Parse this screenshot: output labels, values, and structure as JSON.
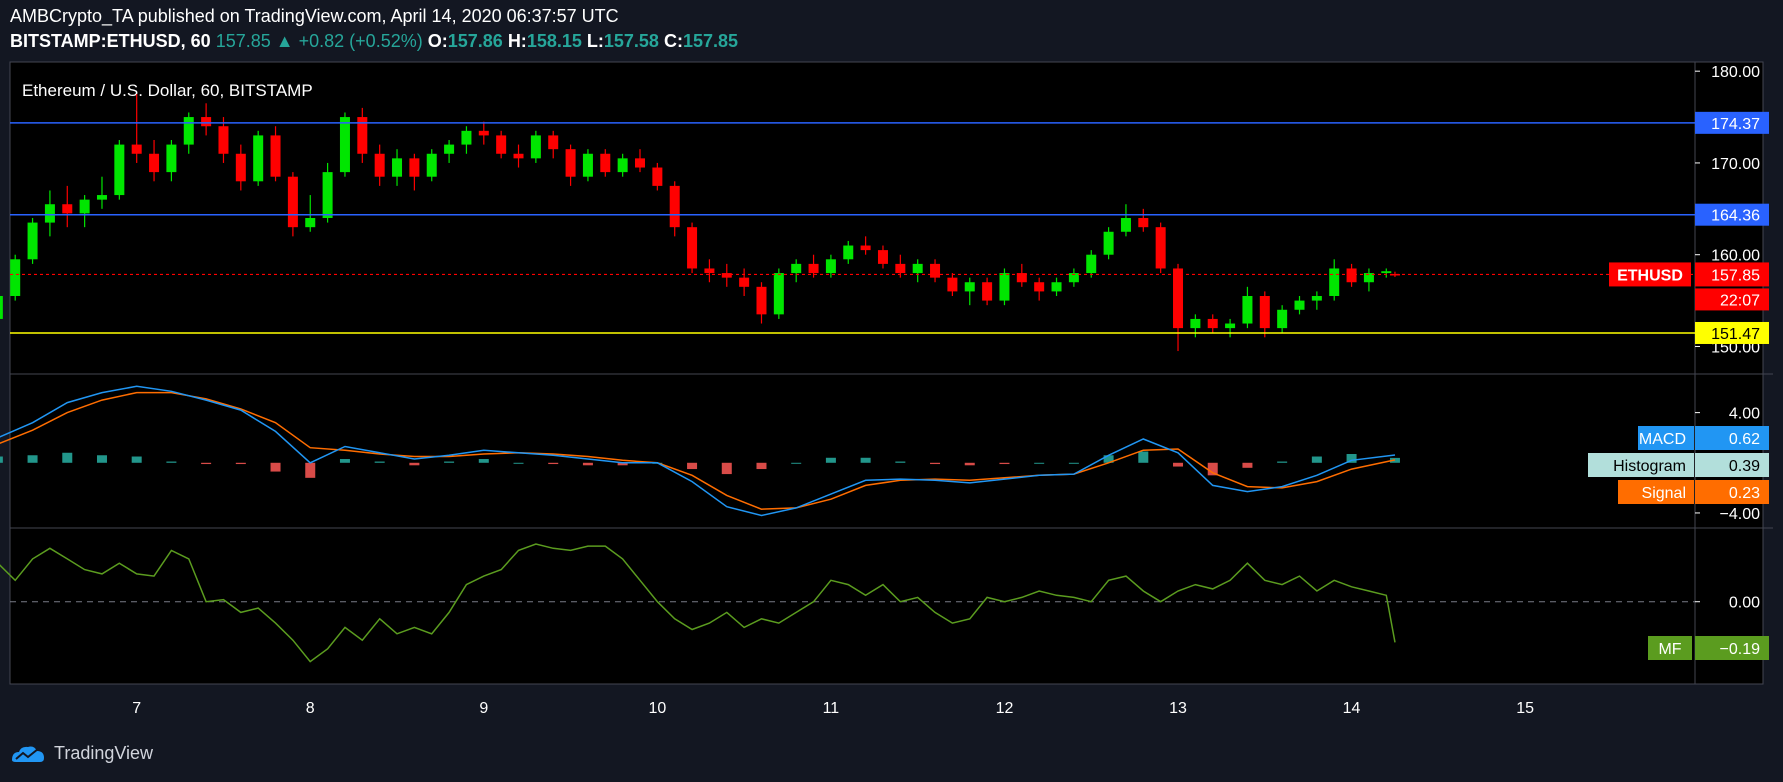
{
  "header": {
    "author_line": "AMBCrypto_TA published on TradingView.com, April 14, 2020 06:37:57 UTC",
    "symbol": "BITSTAMP:ETHUSD, 60",
    "last": "157.85",
    "change_arrow": "▲",
    "change": "+0.82 (+0.52%)",
    "o_label": "O:",
    "o": "157.86",
    "h_label": "H:",
    "h": "158.15",
    "l_label": "L:",
    "l": "157.58",
    "c_label": "C:",
    "c": "157.85"
  },
  "footer": {
    "brand": "TradingView"
  },
  "colors": {
    "background": "#000000",
    "page": "#131722",
    "up": "#00e600",
    "down": "#ff0000",
    "resistance": "#2962ff",
    "support": "#ffff00",
    "macd": "#2196f3",
    "signal": "#ff6d00",
    "hist_pos": "#26a69a",
    "hist_neg": "#ef5350",
    "mf": "#5b9c1f"
  },
  "chart_data": [
    {
      "type": "candlestick",
      "title": "Ethereum / U.S. Dollar, 60, BITSTAMP",
      "ylim": [
        147,
        181
      ],
      "yticks": [
        "180.00",
        "170.00",
        "160.00",
        "150.00"
      ],
      "xticks": [
        "7",
        "8",
        "9",
        "10",
        "11",
        "12",
        "13",
        "14",
        "15"
      ],
      "levels": [
        {
          "name": "resistance-1",
          "value": 174.37,
          "label": "174.37"
        },
        {
          "name": "resistance-2",
          "value": 164.36,
          "label": "164.36"
        },
        {
          "name": "support",
          "value": 151.47,
          "label": "151.47"
        }
      ],
      "last_price": {
        "symbol": "ETHUSD",
        "value": 157.85,
        "label": "157.85",
        "countdown": "22:07"
      },
      "candles": [
        [
          6.0,
          150.0,
          151.2,
          148.5,
          150.6
        ],
        [
          6.1,
          150.6,
          153.5,
          150.3,
          153.0
        ],
        [
          6.2,
          153.0,
          156.0,
          152.5,
          155.5
        ],
        [
          6.3,
          155.5,
          160.0,
          155.0,
          159.5
        ],
        [
          6.4,
          159.5,
          164.0,
          159.0,
          163.5
        ],
        [
          6.5,
          163.5,
          167.0,
          162.0,
          165.5
        ],
        [
          6.6,
          165.5,
          167.5,
          163.0,
          164.5
        ],
        [
          6.7,
          164.5,
          166.5,
          163.0,
          166.0
        ],
        [
          6.8,
          166.0,
          168.5,
          165.0,
          166.5
        ],
        [
          6.9,
          166.5,
          172.5,
          166.0,
          172.0
        ],
        [
          7.0,
          172.0,
          177.5,
          170.0,
          171.0
        ],
        [
          7.1,
          171.0,
          172.5,
          168.0,
          169.0
        ],
        [
          7.2,
          169.0,
          172.5,
          168.0,
          172.0
        ],
        [
          7.3,
          172.0,
          175.5,
          171.0,
          175.0
        ],
        [
          7.4,
          175.0,
          176.5,
          173.0,
          174.0
        ],
        [
          7.5,
          174.0,
          175.0,
          170.0,
          171.0
        ],
        [
          7.6,
          171.0,
          172.0,
          167.0,
          168.0
        ],
        [
          7.7,
          168.0,
          173.5,
          167.5,
          173.0
        ],
        [
          7.8,
          173.0,
          174.0,
          168.0,
          168.5
        ],
        [
          7.9,
          168.5,
          169.0,
          162.0,
          163.0
        ],
        [
          8.0,
          163.0,
          166.5,
          162.5,
          164.0
        ],
        [
          8.1,
          164.0,
          170.0,
          163.5,
          169.0
        ],
        [
          8.2,
          169.0,
          175.5,
          168.5,
          175.0
        ],
        [
          8.3,
          175.0,
          176.0,
          170.0,
          171.0
        ],
        [
          8.4,
          171.0,
          172.0,
          167.5,
          168.5
        ],
        [
          8.5,
          168.5,
          171.5,
          167.5,
          170.5
        ],
        [
          8.6,
          170.5,
          171.0,
          167.0,
          168.5
        ],
        [
          8.7,
          168.5,
          171.5,
          168.0,
          171.0
        ],
        [
          8.8,
          171.0,
          172.5,
          170.0,
          172.0
        ],
        [
          8.9,
          172.0,
          174.0,
          171.0,
          173.5
        ],
        [
          9.0,
          173.5,
          174.5,
          172.0,
          173.0
        ],
        [
          9.1,
          173.0,
          173.5,
          170.5,
          171.0
        ],
        [
          9.2,
          171.0,
          172.0,
          169.5,
          170.5
        ],
        [
          9.3,
          170.5,
          173.5,
          170.0,
          173.0
        ],
        [
          9.4,
          173.0,
          173.5,
          170.5,
          171.5
        ],
        [
          9.5,
          171.5,
          172.0,
          167.5,
          168.5
        ],
        [
          9.6,
          168.5,
          171.5,
          168.0,
          171.0
        ],
        [
          9.7,
          171.0,
          171.5,
          168.5,
          169.0
        ],
        [
          9.8,
          169.0,
          171.0,
          168.5,
          170.5
        ],
        [
          9.9,
          170.5,
          171.5,
          169.0,
          169.5
        ],
        [
          10.0,
          169.5,
          170.0,
          167.0,
          167.5
        ],
        [
          10.1,
          167.5,
          168.0,
          162.0,
          163.0
        ],
        [
          10.2,
          163.0,
          163.5,
          158.0,
          158.5
        ],
        [
          10.3,
          158.5,
          159.5,
          157.0,
          158.0
        ],
        [
          10.4,
          158.0,
          159.0,
          156.5,
          157.5
        ],
        [
          10.5,
          157.5,
          158.5,
          155.5,
          156.5
        ],
        [
          10.6,
          156.5,
          157.0,
          152.5,
          153.5
        ],
        [
          10.7,
          153.5,
          158.5,
          153.0,
          158.0
        ],
        [
          10.8,
          158.0,
          159.5,
          157.0,
          159.0
        ],
        [
          10.9,
          159.0,
          160.0,
          157.5,
          158.0
        ],
        [
          11.0,
          158.0,
          160.0,
          157.5,
          159.5
        ],
        [
          11.1,
          159.5,
          161.5,
          159.0,
          161.0
        ],
        [
          11.2,
          161.0,
          162.0,
          160.0,
          160.5
        ],
        [
          11.3,
          160.5,
          161.0,
          158.5,
          159.0
        ],
        [
          11.4,
          159.0,
          160.0,
          157.5,
          158.0
        ],
        [
          11.5,
          158.0,
          159.5,
          157.0,
          159.0
        ],
        [
          11.6,
          159.0,
          159.5,
          157.0,
          157.5
        ],
        [
          11.7,
          157.5,
          158.0,
          155.5,
          156.0
        ],
        [
          11.8,
          156.0,
          157.5,
          154.5,
          157.0
        ],
        [
          11.9,
          157.0,
          157.5,
          154.5,
          155.0
        ],
        [
          12.0,
          155.0,
          158.5,
          154.5,
          158.0
        ],
        [
          12.1,
          158.0,
          159.0,
          156.5,
          157.0
        ],
        [
          12.2,
          157.0,
          157.5,
          155.0,
          156.0
        ],
        [
          12.3,
          156.0,
          157.5,
          155.5,
          157.0
        ],
        [
          12.4,
          157.0,
          158.5,
          156.5,
          158.0
        ],
        [
          12.5,
          158.0,
          160.5,
          157.5,
          160.0
        ],
        [
          12.6,
          160.0,
          163.0,
          159.5,
          162.5
        ],
        [
          12.7,
          162.5,
          165.5,
          162.0,
          164.0
        ],
        [
          12.8,
          164.0,
          165.0,
          162.5,
          163.0
        ],
        [
          12.9,
          163.0,
          163.5,
          158.0,
          158.5
        ],
        [
          13.0,
          158.5,
          159.0,
          149.5,
          152.0
        ],
        [
          13.1,
          152.0,
          153.5,
          151.0,
          153.0
        ],
        [
          13.2,
          153.0,
          153.5,
          151.5,
          152.0
        ],
        [
          13.3,
          152.0,
          153.0,
          151.0,
          152.5
        ],
        [
          13.4,
          152.5,
          156.5,
          152.0,
          155.5
        ],
        [
          13.5,
          155.5,
          156.0,
          151.0,
          152.0
        ],
        [
          13.6,
          152.0,
          154.5,
          151.5,
          154.0
        ],
        [
          13.7,
          154.0,
          155.5,
          153.5,
          155.0
        ],
        [
          13.8,
          155.0,
          156.0,
          154.0,
          155.5
        ],
        [
          13.9,
          155.5,
          159.5,
          155.0,
          158.5
        ],
        [
          14.0,
          158.5,
          159.0,
          156.5,
          157.0
        ],
        [
          14.1,
          157.0,
          158.5,
          156.0,
          158.0
        ],
        [
          14.2,
          158.0,
          158.5,
          157.5,
          158.2
        ],
        [
          14.25,
          157.9,
          158.15,
          157.58,
          157.85
        ]
      ]
    },
    {
      "type": "line",
      "name": "MACD",
      "ylim": [
        -5.2,
        7.0
      ],
      "yticks": [
        "4.00",
        "−4.00"
      ],
      "legend": [
        {
          "name": "MACD",
          "value": "0.62"
        },
        {
          "name": "Histogram",
          "value": "0.39"
        },
        {
          "name": "Signal",
          "value": "0.23"
        }
      ],
      "x": [
        6.0,
        6.2,
        6.4,
        6.6,
        6.8,
        7.0,
        7.2,
        7.4,
        7.6,
        7.8,
        8.0,
        8.2,
        8.4,
        8.6,
        8.8,
        9.0,
        9.2,
        9.4,
        9.6,
        9.8,
        10.0,
        10.2,
        10.4,
        10.6,
        10.8,
        11.0,
        11.2,
        11.4,
        11.6,
        11.8,
        12.0,
        12.2,
        12.4,
        12.6,
        12.8,
        13.0,
        13.2,
        13.4,
        13.6,
        13.8,
        14.0,
        14.25
      ],
      "macd": [
        1.0,
        2.0,
        3.2,
        4.8,
        5.6,
        6.1,
        5.7,
        5.0,
        4.2,
        2.5,
        0.0,
        1.3,
        0.8,
        0.3,
        0.6,
        1.0,
        0.8,
        0.6,
        0.3,
        0.0,
        0.0,
        -1.5,
        -3.5,
        -4.2,
        -3.6,
        -2.5,
        -1.4,
        -1.3,
        -1.4,
        -1.6,
        -1.3,
        -1.0,
        -0.9,
        0.6,
        1.9,
        0.8,
        -1.8,
        -2.3,
        -1.9,
        -1.0,
        0.2,
        0.62
      ],
      "signal": [
        0.5,
        1.5,
        2.6,
        4.0,
        5.0,
        5.6,
        5.6,
        5.1,
        4.3,
        3.2,
        1.2,
        1.0,
        0.7,
        0.5,
        0.5,
        0.7,
        0.8,
        0.7,
        0.5,
        0.2,
        0.0,
        -1.0,
        -2.6,
        -3.7,
        -3.6,
        -2.9,
        -1.8,
        -1.4,
        -1.3,
        -1.4,
        -1.2,
        -1.0,
        -0.9,
        0.0,
        1.0,
        1.1,
        -0.8,
        -1.9,
        -2.0,
        -1.5,
        -0.5,
        0.23
      ],
      "histogram": [
        0.5,
        0.5,
        0.6,
        0.8,
        0.6,
        0.5,
        0.1,
        -0.1,
        -0.1,
        -0.7,
        -1.2,
        0.3,
        0.1,
        -0.2,
        0.1,
        0.3,
        0.0,
        -0.1,
        -0.2,
        -0.2,
        0.0,
        -0.5,
        -0.9,
        -0.5,
        0.0,
        0.4,
        0.4,
        0.1,
        -0.1,
        -0.2,
        -0.1,
        0.0,
        0.0,
        0.6,
        0.9,
        -0.3,
        -1.0,
        -0.4,
        0.1,
        0.5,
        0.7,
        0.39
      ]
    },
    {
      "type": "line",
      "name": "MF",
      "ylim": [
        -0.38,
        0.34
      ],
      "yticks": [
        "0.00"
      ],
      "legend": [
        {
          "name": "MF",
          "value": "−0.19"
        }
      ],
      "x": [
        6.0,
        6.1,
        6.2,
        6.3,
        6.4,
        6.5,
        6.6,
        6.7,
        6.8,
        6.9,
        7.0,
        7.1,
        7.2,
        7.3,
        7.4,
        7.5,
        7.6,
        7.7,
        7.8,
        7.9,
        8.0,
        8.1,
        8.2,
        8.3,
        8.4,
        8.5,
        8.6,
        8.7,
        8.8,
        8.9,
        9.0,
        9.1,
        9.2,
        9.3,
        9.4,
        9.5,
        9.6,
        9.7,
        9.8,
        9.9,
        10.0,
        10.1,
        10.2,
        10.3,
        10.4,
        10.5,
        10.6,
        10.7,
        10.8,
        10.9,
        11.0,
        11.1,
        11.2,
        11.3,
        11.4,
        11.5,
        11.6,
        11.7,
        11.8,
        11.9,
        12.0,
        12.1,
        12.2,
        12.3,
        12.4,
        12.5,
        12.6,
        12.7,
        12.8,
        12.9,
        13.0,
        13.1,
        13.2,
        13.3,
        13.4,
        13.5,
        13.6,
        13.7,
        13.8,
        13.9,
        14.0,
        14.1,
        14.2,
        14.25
      ],
      "values": [
        0.22,
        0.25,
        0.18,
        0.1,
        0.2,
        0.25,
        0.2,
        0.15,
        0.13,
        0.18,
        0.13,
        0.12,
        0.24,
        0.2,
        0.0,
        0.01,
        -0.05,
        -0.03,
        -0.1,
        -0.18,
        -0.28,
        -0.22,
        -0.12,
        -0.18,
        -0.08,
        -0.15,
        -0.12,
        -0.15,
        -0.05,
        0.08,
        0.12,
        0.15,
        0.24,
        0.27,
        0.25,
        0.24,
        0.26,
        0.26,
        0.2,
        0.1,
        0.0,
        -0.08,
        -0.13,
        -0.1,
        -0.05,
        -0.12,
        -0.08,
        -0.1,
        -0.05,
        0.0,
        0.1,
        0.08,
        0.03,
        0.08,
        0.0,
        0.02,
        -0.05,
        -0.1,
        -0.08,
        0.02,
        0.0,
        0.02,
        0.05,
        0.03,
        0.02,
        0.0,
        0.1,
        0.12,
        0.05,
        0.0,
        0.05,
        0.08,
        0.06,
        0.1,
        0.18,
        0.1,
        0.08,
        0.12,
        0.05,
        0.1,
        0.07,
        0.05,
        0.03,
        -0.19
      ]
    }
  ]
}
